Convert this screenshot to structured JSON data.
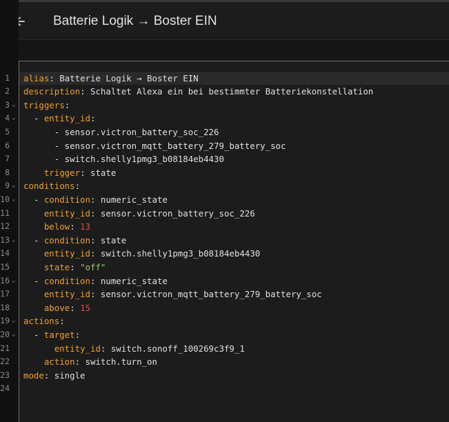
{
  "header": {
    "title": "Batterie Logik → Boster EIN",
    "back_icon": "arrow-left-icon"
  },
  "editor": {
    "lines": [
      {
        "num": "1",
        "fold": false,
        "segs": [
          [
            "k",
            "alias"
          ],
          [
            "p",
            ": Batterie Logik → Boster EIN"
          ]
        ]
      },
      {
        "num": "2",
        "fold": false,
        "segs": [
          [
            "k",
            "description"
          ],
          [
            "p",
            ": Schaltet Alexa ein bei bestimmter Batteriekonstellation"
          ]
        ]
      },
      {
        "num": "3",
        "fold": true,
        "segs": [
          [
            "k",
            "triggers"
          ],
          [
            "p",
            ":"
          ]
        ]
      },
      {
        "num": "4",
        "fold": true,
        "segs": [
          [
            "p",
            "  - "
          ],
          [
            "k",
            "entity_id"
          ],
          [
            "p",
            ":"
          ]
        ]
      },
      {
        "num": "5",
        "fold": false,
        "segs": [
          [
            "p",
            "      - sensor.victron_battery_soc_226"
          ]
        ]
      },
      {
        "num": "6",
        "fold": false,
        "segs": [
          [
            "p",
            "      - sensor.victron_mqtt_battery_279_battery_soc"
          ]
        ]
      },
      {
        "num": "7",
        "fold": false,
        "segs": [
          [
            "p",
            "      - switch.shelly1pmg3_b08184eb4430"
          ]
        ]
      },
      {
        "num": "8",
        "fold": false,
        "segs": [
          [
            "p",
            "    "
          ],
          [
            "k",
            "trigger"
          ],
          [
            "p",
            ": state"
          ]
        ]
      },
      {
        "num": "9",
        "fold": true,
        "segs": [
          [
            "k",
            "conditions"
          ],
          [
            "p",
            ":"
          ]
        ]
      },
      {
        "num": "10",
        "fold": true,
        "segs": [
          [
            "p",
            "  - "
          ],
          [
            "k",
            "condition"
          ],
          [
            "p",
            ": numeric_state"
          ]
        ]
      },
      {
        "num": "11",
        "fold": false,
        "segs": [
          [
            "p",
            "    "
          ],
          [
            "k",
            "entity_id"
          ],
          [
            "p",
            ": sensor.victron_battery_soc_226"
          ]
        ]
      },
      {
        "num": "12",
        "fold": false,
        "segs": [
          [
            "p",
            "    "
          ],
          [
            "k",
            "below"
          ],
          [
            "p",
            ": "
          ],
          [
            "n",
            "13"
          ]
        ]
      },
      {
        "num": "13",
        "fold": true,
        "segs": [
          [
            "p",
            "  - "
          ],
          [
            "k",
            "condition"
          ],
          [
            "p",
            ": state"
          ]
        ]
      },
      {
        "num": "14",
        "fold": false,
        "segs": [
          [
            "p",
            "    "
          ],
          [
            "k",
            "entity_id"
          ],
          [
            "p",
            ": switch.shelly1pmg3_b08184eb4430"
          ]
        ]
      },
      {
        "num": "15",
        "fold": false,
        "segs": [
          [
            "p",
            "    "
          ],
          [
            "k",
            "state"
          ],
          [
            "p",
            ": "
          ],
          [
            "s",
            "\"off\""
          ]
        ]
      },
      {
        "num": "16",
        "fold": true,
        "segs": [
          [
            "p",
            "  - "
          ],
          [
            "k",
            "condition"
          ],
          [
            "p",
            ": numeric_state"
          ]
        ]
      },
      {
        "num": "17",
        "fold": false,
        "segs": [
          [
            "p",
            "    "
          ],
          [
            "k",
            "entity_id"
          ],
          [
            "p",
            ": sensor.victron_mqtt_battery_279_battery_soc"
          ]
        ]
      },
      {
        "num": "18",
        "fold": false,
        "segs": [
          [
            "p",
            "    "
          ],
          [
            "k",
            "above"
          ],
          [
            "p",
            ": "
          ],
          [
            "n",
            "15"
          ]
        ]
      },
      {
        "num": "19",
        "fold": true,
        "segs": [
          [
            "k",
            "actions"
          ],
          [
            "p",
            ":"
          ]
        ]
      },
      {
        "num": "20",
        "fold": true,
        "segs": [
          [
            "p",
            "  - "
          ],
          [
            "k",
            "target"
          ],
          [
            "p",
            ":"
          ]
        ]
      },
      {
        "num": "21",
        "fold": false,
        "segs": [
          [
            "p",
            "      "
          ],
          [
            "k",
            "entity_id"
          ],
          [
            "p",
            ": switch.sonoff_100269c3f9_1"
          ]
        ]
      },
      {
        "num": "22",
        "fold": false,
        "segs": [
          [
            "p",
            "    "
          ],
          [
            "k",
            "action"
          ],
          [
            "p",
            ": switch.turn_on"
          ]
        ]
      },
      {
        "num": "23",
        "fold": false,
        "segs": [
          [
            "k",
            "mode"
          ],
          [
            "p",
            ": single"
          ]
        ]
      },
      {
        "num": "24",
        "fold": false,
        "segs": []
      }
    ]
  },
  "colors": {
    "key": "#f0a030",
    "number": "#e04e4e",
    "string": "#9fd06e",
    "text": "#e0e0e0",
    "background": "#1c1c1c"
  }
}
